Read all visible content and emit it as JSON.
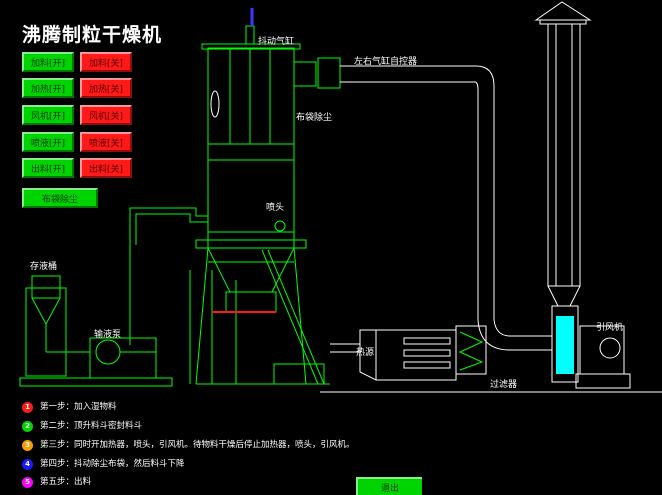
{
  "title": "沸腾制粒干燥机",
  "colors": {
    "on": "#00d400",
    "off": "#ff1a1a",
    "line": "#00ff00",
    "pipe": "#ffffff",
    "accent": "#00ffff"
  },
  "buttons": [
    {
      "on": "加料[开]",
      "off": "加料[关]"
    },
    {
      "on": "加热[开]",
      "off": "加热[关]"
    },
    {
      "on": "风机[开]",
      "off": "风机[关]"
    },
    {
      "on": "喷液[开]",
      "off": "喷液[关]"
    },
    {
      "on": "出料[开]",
      "off": "出料[关]"
    }
  ],
  "bag_dust_button": "布袋除尘",
  "labels": {
    "shake_cylinder": "抖动气缸",
    "lr_cylinder": "左右气缸自控器",
    "bag_filter": "布袋除尘",
    "nozzle": "喷头",
    "liquid_tank": "存液桶",
    "pump": "输液泵",
    "heater": "热源",
    "filter": "过滤器",
    "fan": "引风机"
  },
  "steps": [
    {
      "num": "1",
      "color": "#ff1a1a",
      "text": "第一步：加入湿物料"
    },
    {
      "num": "2",
      "color": "#00d400",
      "text": "第二步：顶升料斗密封料斗"
    },
    {
      "num": "3",
      "color": "#ff9900",
      "text": "第三步：同时开加热器，喷头，引风机。待物料干燥后停止加热器，喷头，引风机。"
    },
    {
      "num": "4",
      "color": "#1a1aff",
      "text": "第四步：抖动除尘布袋，然后料斗下降"
    },
    {
      "num": "5",
      "color": "#ff00ff",
      "text": "第五步：出料"
    }
  ],
  "exit_button": "退出"
}
